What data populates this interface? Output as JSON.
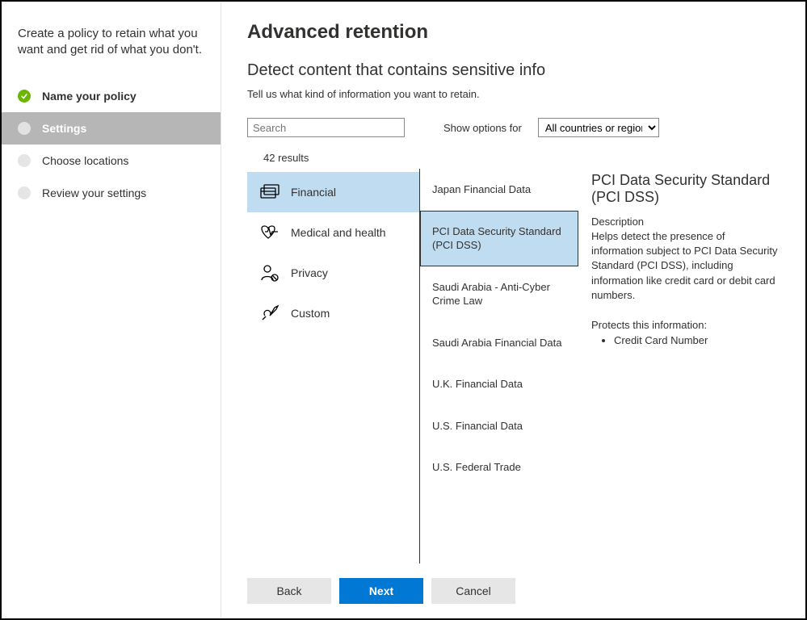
{
  "sidebar": {
    "intro": "Create a policy to retain what you want and get rid of what you don't.",
    "steps": [
      {
        "label": "Name your policy",
        "state": "done"
      },
      {
        "label": "Settings",
        "state": "active"
      },
      {
        "label": "Choose locations",
        "state": "pending"
      },
      {
        "label": "Review your settings",
        "state": "pending"
      }
    ]
  },
  "main": {
    "heading": "Advanced retention",
    "subheading": "Detect content that contains sensitive info",
    "hint": "Tell us what kind of information you want to retain.",
    "search": {
      "placeholder": "Search"
    },
    "filter": {
      "label": "Show options for",
      "selected": "All countries or regions"
    },
    "results_count": "42 results",
    "categories": [
      {
        "label": "Financial",
        "icon": "card-icon",
        "selected": true
      },
      {
        "label": "Medical and health",
        "icon": "health-icon",
        "selected": false
      },
      {
        "label": "Privacy",
        "icon": "privacy-icon",
        "selected": false
      },
      {
        "label": "Custom",
        "icon": "custom-icon",
        "selected": false
      }
    ],
    "list": [
      {
        "label": "Japan Financial Data",
        "selected": false
      },
      {
        "label": "PCI Data Security Standard (PCI DSS)",
        "selected": true
      },
      {
        "label": "Saudi Arabia - Anti-Cyber Crime Law",
        "selected": false
      },
      {
        "label": "Saudi Arabia Financial Data",
        "selected": false
      },
      {
        "label": "U.K. Financial Data",
        "selected": false
      },
      {
        "label": "U.S. Financial Data",
        "selected": false
      },
      {
        "label": "U.S. Federal Trade",
        "selected": false
      }
    ],
    "detail": {
      "title": "PCI Data Security Standard (PCI DSS)",
      "description_label": "Description",
      "description": "Helps detect the presence of information subject to PCI Data Security Standard (PCI DSS), including information like credit card or debit card numbers.",
      "protects_label": "Protects this information:",
      "protects": [
        "Credit Card Number"
      ]
    }
  },
  "footer": {
    "back": "Back",
    "next": "Next",
    "cancel": "Cancel"
  }
}
